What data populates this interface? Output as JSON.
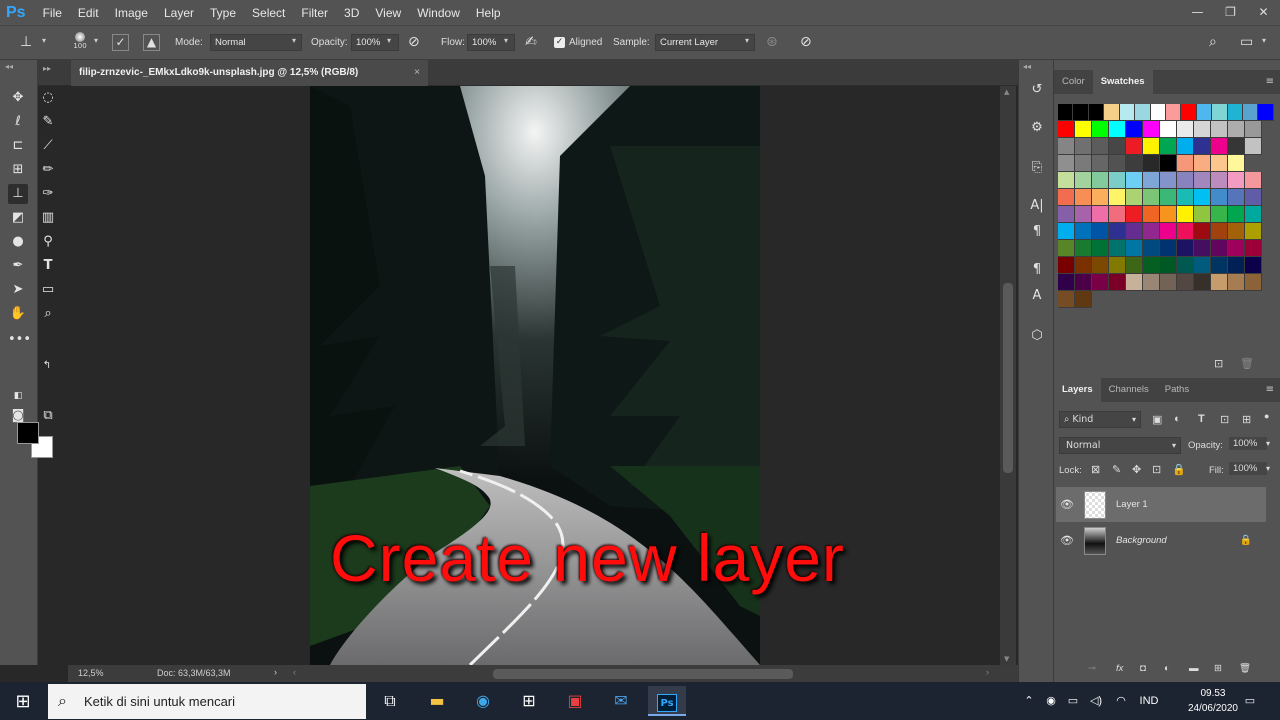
{
  "app": {
    "logo": "Ps"
  },
  "menu": [
    "File",
    "Edit",
    "Image",
    "Layer",
    "Type",
    "Select",
    "Filter",
    "3D",
    "View",
    "Window",
    "Help"
  ],
  "window_controls": {
    "minimize": "—",
    "restore": "❐",
    "close": "✕"
  },
  "options": {
    "brush_size": "100",
    "mode_label": "Mode:",
    "mode_value": "Normal",
    "opacity_label": "Opacity:",
    "opacity_value": "100%",
    "flow_label": "Flow:",
    "flow_value": "100%",
    "aligned_label": "Aligned",
    "aligned_checked": true,
    "sample_label": "Sample:",
    "sample_value": "Current Layer"
  },
  "document": {
    "tab_title": "filip-zrnzevic-_EMkxLdko9k-unsplash.jpg @ 12,5% (RGB/8)",
    "tab_close": "×",
    "zoom": "12,5%",
    "doc_info": "Doc: 63,3M/63,3M",
    "caption": "Create new layer"
  },
  "tools": [
    "move-tool",
    "marquee-tool",
    "lasso-tool",
    "quick-selection-tool",
    "crop-tool",
    "eyedropper-tool",
    "frame-tool",
    "brush-tool",
    "clone-stamp-tool",
    "history-brush-tool",
    "eraser-tool",
    "gradient-tool",
    "blur-tool",
    "dodge-tool",
    "pen-tool",
    "type-tool",
    "path-selection-tool",
    "rectangle-tool",
    "hand-tool",
    "zoom-tool"
  ],
  "swatches_panel": {
    "tabs": [
      "Color",
      "Swatches"
    ],
    "active_tab": "Swatches",
    "colors": [
      [
        "#000000",
        "#000000",
        "#000000",
        "#f4d089",
        "#b7e9f0",
        "#9ad7e0",
        "#ffffff",
        "#fb9b9b",
        "#ff0000",
        "#4fb7f0",
        "#7fd4d4",
        "#1fb3d4",
        "#5aa2d0",
        "#0000ff"
      ],
      [
        "#ff0000",
        "#ffff00",
        "#00ff00",
        "#00ffff",
        "#0000ff",
        "#ff00ff",
        "#ffffff",
        "#ebebeb",
        "#d6d6d6",
        "#c2c2c2",
        "#adadad",
        "#999999"
      ],
      [
        "#858585",
        "#707070",
        "#5c5c5c",
        "#474747",
        "#ed1c24",
        "#fff200",
        "#00a651",
        "#00aeef",
        "#2e3192",
        "#ec008c",
        "#363636",
        "#c2c2c2"
      ],
      [
        "#8f8f8f",
        "#7a7a7a",
        "#666666",
        "#525252",
        "#3d3d3d",
        "#292929",
        "#000000",
        "#f7977a",
        "#fbad82",
        "#fdc68c",
        "#fff799"
      ],
      [
        "#c4df9b",
        "#a2d39c",
        "#82ca9c",
        "#7bcdc8",
        "#6ecff6",
        "#7ea7d8",
        "#8493ca",
        "#8882be",
        "#a187be",
        "#bc8cbf",
        "#f49bc1",
        "#f5989d"
      ],
      [
        "#f26c4f",
        "#f68e55",
        "#fbaf5c",
        "#fff467",
        "#acd372",
        "#7cc576",
        "#3bb878",
        "#1abbb4",
        "#00bff3",
        "#438ccb",
        "#5574b9",
        "#605ca8"
      ],
      [
        "#855fa8",
        "#a763a9",
        "#ef6ea8",
        "#f16d7e",
        "#ee1d24",
        "#f16522",
        "#f7941d",
        "#fff100",
        "#8fc63d",
        "#37b44a",
        "#00a650",
        "#00a99e"
      ],
      [
        "#00aeef",
        "#0072bc",
        "#0054a5",
        "#2f3192",
        "#652c91",
        "#91278f",
        "#ed008c",
        "#ee105a",
        "#9d0a0f",
        "#a1410d",
        "#a36209",
        "#aba000"
      ],
      [
        "#588528",
        "#197b30",
        "#007236",
        "#00736a",
        "#0076a4",
        "#004a80",
        "#003370",
        "#1d1363",
        "#450e61",
        "#62055f",
        "#9e005c",
        "#9d0039"
      ],
      [
        "#790000",
        "#7b3000",
        "#7c4900",
        "#827a00",
        "#3e6617",
        "#045f20",
        "#005824",
        "#005951",
        "#005b7e",
        "#003562",
        "#002056",
        "#0c004b"
      ],
      [
        "#30004a",
        "#4b0048",
        "#7a0045",
        "#7a0026",
        "#c7b299",
        "#998675",
        "#736357",
        "#534741",
        "#37302a",
        "#c69c6d",
        "#a67c52",
        "#8c6239"
      ],
      [
        "#754c24",
        "#603913"
      ]
    ]
  },
  "layers_panel": {
    "tabs": [
      "Layers",
      "Channels",
      "Paths"
    ],
    "active_tab": "Layers",
    "filter_label": "Kind",
    "blend_mode": "Normal",
    "opacity_label": "Opacity:",
    "opacity_value": "100%",
    "lock_label": "Lock:",
    "fill_label": "Fill:",
    "fill_value": "100%",
    "layers": [
      {
        "name": "Layer 1",
        "selected": true
      },
      {
        "name": "Background",
        "selected": false,
        "locked": true
      }
    ]
  },
  "taskbar": {
    "search_placeholder": "Ketik di sini untuk mencari",
    "language": "IND",
    "time": "09.53",
    "date": "24/06/2020"
  }
}
